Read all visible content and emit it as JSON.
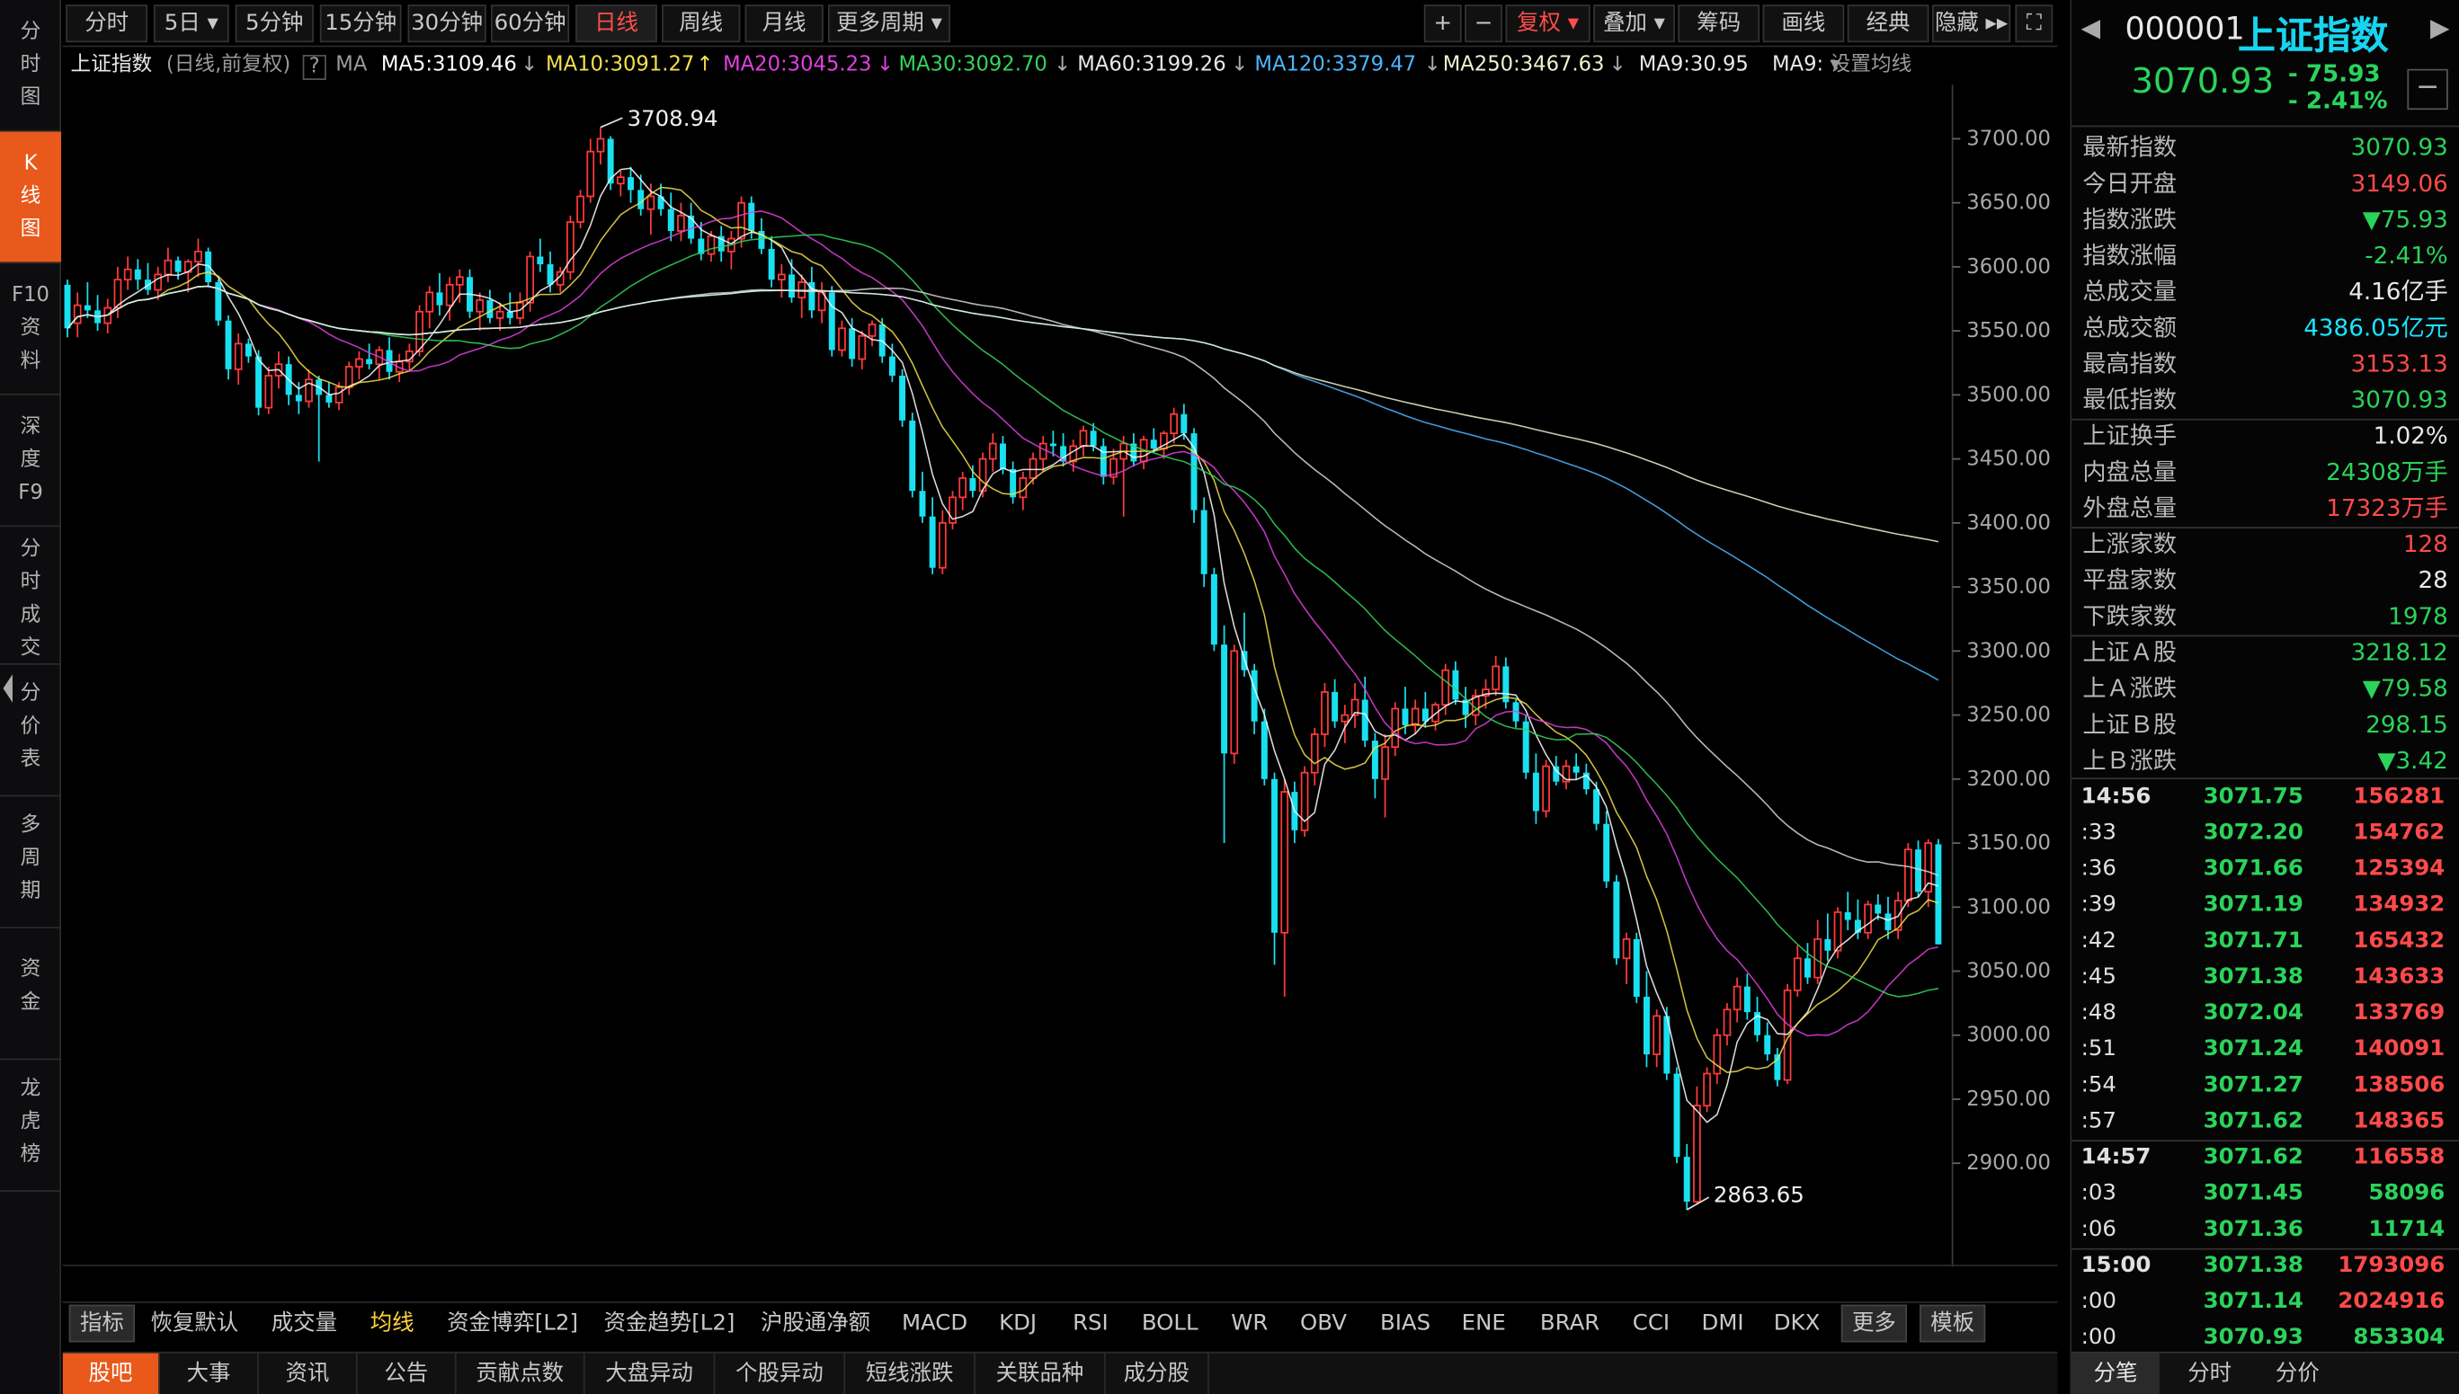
{
  "left_nav": [
    {
      "label": "分\n时\n图"
    },
    {
      "label": "K\n线\n图"
    },
    {
      "label": "F10\n资\n料"
    },
    {
      "label": "深\n度\nF9"
    },
    {
      "label": "分\n时\n成\n交"
    },
    {
      "label": "分\n价\n表"
    },
    {
      "label": "多\n周\n期"
    },
    {
      "label": "资\n金"
    },
    {
      "label": "龙\n虎\n榜"
    }
  ],
  "period_tabs": [
    "分时",
    "5日",
    "5分钟",
    "15分钟",
    "30分钟",
    "60分钟",
    "日线",
    "周线",
    "月线",
    "更多周期"
  ],
  "tools": {
    "plus": "+",
    "minus": "−",
    "fuquan": "复权",
    "diejia": "叠加",
    "chouma": "筹码",
    "huaxian": "画线",
    "jingdian": "经典",
    "yincang": "隐藏",
    "expand": "⛶"
  },
  "ma_bar": {
    "title": "上证指数",
    "mode": "(日线,前复权)",
    "q": "?",
    "ma": "MA",
    "ma5": "MA5:3109.46",
    "ma10": "MA10:3091.27",
    "ma20": "MA20:3045.23",
    "ma30": "MA30:3092.70",
    "ma60": "MA60:3199.26",
    "ma120": "MA120:3379.47",
    "ma250": "MA250:3467.63",
    "ma9": "MA9:30.95",
    "ma9b": "MA9:",
    "setting": "设置均线"
  },
  "chart_data": {
    "type": "candlestick",
    "ylim": [
      2830,
      3730
    ],
    "yticks": [
      "3700.00",
      "3650.00",
      "3600.00",
      "3550.00",
      "3500.00",
      "3450.00",
      "3400.00",
      "3350.00",
      "3300.00",
      "3250.00",
      "3200.00",
      "3150.00",
      "3100.00",
      "3050.00",
      "3000.00",
      "2950.00",
      "2900.00"
    ],
    "high_label": "3708.94",
    "low_label": "2863.65",
    "ohlc": [
      [
        3586,
        3590,
        3545,
        3552
      ],
      [
        3556,
        3580,
        3545,
        3570
      ],
      [
        3570,
        3588,
        3560,
        3566
      ],
      [
        3566,
        3578,
        3550,
        3556
      ],
      [
        3556,
        3575,
        3548,
        3568
      ],
      [
        3568,
        3600,
        3560,
        3590
      ],
      [
        3590,
        3608,
        3582,
        3598
      ],
      [
        3598,
        3606,
        3582,
        3590
      ],
      [
        3590,
        3603,
        3578,
        3582
      ],
      [
        3582,
        3600,
        3574,
        3594
      ],
      [
        3594,
        3615,
        3588,
        3605
      ],
      [
        3605,
        3608,
        3590,
        3596
      ],
      [
        3596,
        3606,
        3580,
        3604
      ],
      [
        3604,
        3622,
        3592,
        3612
      ],
      [
        3612,
        3615,
        3584,
        3588
      ],
      [
        3588,
        3590,
        3554,
        3558
      ],
      [
        3558,
        3562,
        3512,
        3520
      ],
      [
        3520,
        3548,
        3508,
        3540
      ],
      [
        3540,
        3544,
        3525,
        3530
      ],
      [
        3530,
        3535,
        3484,
        3490
      ],
      [
        3490,
        3522,
        3485,
        3515
      ],
      [
        3515,
        3534,
        3505,
        3524
      ],
      [
        3524,
        3530,
        3492,
        3500
      ],
      [
        3500,
        3510,
        3485,
        3495
      ],
      [
        3495,
        3520,
        3490,
        3512
      ],
      [
        3512,
        3515,
        3448,
        3500
      ],
      [
        3500,
        3510,
        3490,
        3494
      ],
      [
        3494,
        3510,
        3488,
        3506
      ],
      [
        3506,
        3526,
        3500,
        3522
      ],
      [
        3522,
        3534,
        3512,
        3528
      ],
      [
        3528,
        3540,
        3520,
        3524
      ],
      [
        3524,
        3538,
        3512,
        3535
      ],
      [
        3535,
        3545,
        3512,
        3518
      ],
      [
        3518,
        3532,
        3510,
        3526
      ],
      [
        3526,
        3540,
        3518,
        3534
      ],
      [
        3534,
        3570,
        3530,
        3565
      ],
      [
        3565,
        3585,
        3552,
        3580
      ],
      [
        3580,
        3595,
        3562,
        3570
      ],
      [
        3570,
        3592,
        3558,
        3586
      ],
      [
        3586,
        3598,
        3572,
        3592
      ],
      [
        3592,
        3598,
        3560,
        3565
      ],
      [
        3565,
        3580,
        3550,
        3574
      ],
      [
        3574,
        3582,
        3556,
        3560
      ],
      [
        3560,
        3572,
        3550,
        3565
      ],
      [
        3565,
        3580,
        3555,
        3560
      ],
      [
        3560,
        3580,
        3555,
        3572
      ],
      [
        3572,
        3612,
        3565,
        3608
      ],
      [
        3608,
        3622,
        3596,
        3602
      ],
      [
        3602,
        3612,
        3580,
        3586
      ],
      [
        3586,
        3600,
        3580,
        3596
      ],
      [
        3596,
        3640,
        3590,
        3635
      ],
      [
        3635,
        3660,
        3630,
        3655
      ],
      [
        3655,
        3700,
        3650,
        3690
      ],
      [
        3690,
        3708.94,
        3680,
        3700
      ],
      [
        3700,
        3702,
        3660,
        3665
      ],
      [
        3665,
        3675,
        3655,
        3670
      ],
      [
        3670,
        3678,
        3650,
        3660
      ],
      [
        3660,
        3672,
        3640,
        3645
      ],
      [
        3645,
        3665,
        3625,
        3655
      ],
      [
        3655,
        3665,
        3640,
        3645
      ],
      [
        3645,
        3658,
        3620,
        3628
      ],
      [
        3628,
        3650,
        3620,
        3640
      ],
      [
        3640,
        3650,
        3618,
        3622
      ],
      [
        3622,
        3635,
        3605,
        3610
      ],
      [
        3610,
        3628,
        3604,
        3624
      ],
      [
        3624,
        3632,
        3604,
        3612
      ],
      [
        3612,
        3628,
        3598,
        3622
      ],
      [
        3622,
        3655,
        3615,
        3650
      ],
      [
        3650,
        3655,
        3622,
        3628
      ],
      [
        3628,
        3638,
        3610,
        3614
      ],
      [
        3614,
        3624,
        3584,
        3590
      ],
      [
        3590,
        3602,
        3576,
        3594
      ],
      [
        3594,
        3606,
        3572,
        3576
      ],
      [
        3576,
        3594,
        3560,
        3588
      ],
      [
        3588,
        3600,
        3560,
        3566
      ],
      [
        3566,
        3588,
        3556,
        3580
      ],
      [
        3580,
        3585,
        3530,
        3535
      ],
      [
        3535,
        3558,
        3530,
        3552
      ],
      [
        3552,
        3560,
        3522,
        3528
      ],
      [
        3528,
        3550,
        3520,
        3546
      ],
      [
        3546,
        3558,
        3538,
        3555
      ],
      [
        3555,
        3560,
        3525,
        3530
      ],
      [
        3530,
        3540,
        3510,
        3515
      ],
      [
        3515,
        3520,
        3475,
        3480
      ],
      [
        3480,
        3486,
        3420,
        3425
      ],
      [
        3425,
        3440,
        3400,
        3405
      ],
      [
        3405,
        3420,
        3360,
        3365
      ],
      [
        3365,
        3410,
        3360,
        3400
      ],
      [
        3400,
        3425,
        3395,
        3420
      ],
      [
        3420,
        3440,
        3410,
        3435
      ],
      [
        3435,
        3445,
        3420,
        3425
      ],
      [
        3425,
        3455,
        3420,
        3450
      ],
      [
        3450,
        3470,
        3440,
        3462
      ],
      [
        3462,
        3468,
        3438,
        3442
      ],
      [
        3442,
        3448,
        3415,
        3420
      ],
      [
        3420,
        3440,
        3410,
        3435
      ],
      [
        3435,
        3455,
        3430,
        3450
      ],
      [
        3450,
        3468,
        3440,
        3462
      ],
      [
        3462,
        3472,
        3452,
        3460
      ],
      [
        3460,
        3470,
        3444,
        3448
      ],
      [
        3448,
        3465,
        3440,
        3460
      ],
      [
        3460,
        3476,
        3452,
        3472
      ],
      [
        3472,
        3478,
        3456,
        3460
      ],
      [
        3460,
        3466,
        3430,
        3436
      ],
      [
        3436,
        3458,
        3430,
        3450
      ],
      [
        3450,
        3468,
        3405,
        3462
      ],
      [
        3462,
        3470,
        3444,
        3448
      ],
      [
        3448,
        3468,
        3442,
        3465
      ],
      [
        3465,
        3474,
        3455,
        3458
      ],
      [
        3458,
        3472,
        3450,
        3470
      ],
      [
        3470,
        3490,
        3462,
        3485
      ],
      [
        3485,
        3493,
        3465,
        3470
      ],
      [
        3470,
        3474,
        3400,
        3410
      ],
      [
        3410,
        3420,
        3350,
        3360
      ],
      [
        3360,
        3365,
        3300,
        3305
      ],
      [
        3305,
        3320,
        3150,
        3220
      ],
      [
        3220,
        3305,
        3212,
        3300
      ],
      [
        3300,
        3330,
        3280,
        3285
      ],
      [
        3285,
        3290,
        3235,
        3245
      ],
      [
        3245,
        3255,
        3195,
        3200
      ],
      [
        3200,
        3205,
        3055,
        3080
      ],
      [
        3080,
        3200,
        3030,
        3190
      ],
      [
        3190,
        3198,
        3150,
        3160
      ],
      [
        3160,
        3210,
        3155,
        3205
      ],
      [
        3205,
        3240,
        3195,
        3235
      ],
      [
        3235,
        3275,
        3225,
        3268
      ],
      [
        3268,
        3278,
        3240,
        3245
      ],
      [
        3245,
        3258,
        3228,
        3250
      ],
      [
        3250,
        3275,
        3240,
        3262
      ],
      [
        3262,
        3280,
        3225,
        3230
      ],
      [
        3230,
        3236,
        3185,
        3200
      ],
      [
        3200,
        3235,
        3170,
        3225
      ],
      [
        3225,
        3260,
        3218,
        3255
      ],
      [
        3255,
        3272,
        3235,
        3242
      ],
      [
        3242,
        3262,
        3235,
        3255
      ],
      [
        3255,
        3268,
        3240,
        3245
      ],
      [
        3245,
        3260,
        3238,
        3258
      ],
      [
        3258,
        3290,
        3250,
        3285
      ],
      [
        3285,
        3292,
        3258,
        3262
      ],
      [
        3262,
        3272,
        3240,
        3250
      ],
      [
        3250,
        3270,
        3242,
        3265
      ],
      [
        3265,
        3278,
        3255,
        3270
      ],
      [
        3270,
        3296,
        3265,
        3288
      ],
      [
        3288,
        3295,
        3255,
        3260
      ],
      [
        3260,
        3262,
        3240,
        3245
      ],
      [
        3245,
        3250,
        3200,
        3205
      ],
      [
        3205,
        3220,
        3165,
        3175
      ],
      [
        3175,
        3215,
        3170,
        3210
      ],
      [
        3210,
        3218,
        3195,
        3198
      ],
      [
        3198,
        3215,
        3192,
        3210
      ],
      [
        3210,
        3220,
        3200,
        3205
      ],
      [
        3205,
        3212,
        3188,
        3192
      ],
      [
        3192,
        3198,
        3160,
        3165
      ],
      [
        3165,
        3175,
        3115,
        3120
      ],
      [
        3120,
        3125,
        3055,
        3060
      ],
      [
        3060,
        3080,
        3040,
        3075
      ],
      [
        3075,
        3080,
        3025,
        3030
      ],
      [
        3030,
        3050,
        2975,
        2985
      ],
      [
        2985,
        3020,
        2975,
        3015
      ],
      [
        3015,
        3022,
        2965,
        2970
      ],
      [
        2970,
        2975,
        2900,
        2905
      ],
      [
        2905,
        2915,
        2863.65,
        2870
      ],
      [
        2870,
        2960,
        2868,
        2945
      ],
      [
        2945,
        2975,
        2940,
        2970
      ],
      [
        2970,
        3005,
        2962,
        3000
      ],
      [
        3000,
        3025,
        2992,
        3020
      ],
      [
        3020,
        3045,
        3010,
        3038
      ],
      [
        3038,
        3048,
        3012,
        3018
      ],
      [
        3018,
        3030,
        2995,
        3000
      ],
      [
        3000,
        3010,
        2980,
        2985
      ],
      [
        2985,
        2990,
        2960,
        2965
      ],
      [
        2965,
        3040,
        2962,
        3035
      ],
      [
        3035,
        3070,
        3030,
        3060
      ],
      [
        3060,
        3072,
        3040,
        3045
      ],
      [
        3045,
        3090,
        3040,
        3075
      ],
      [
        3075,
        3095,
        3058,
        3066
      ],
      [
        3066,
        3100,
        3060,
        3096
      ],
      [
        3096,
        3112,
        3082,
        3090
      ],
      [
        3090,
        3106,
        3075,
        3080
      ],
      [
        3080,
        3105,
        3075,
        3102
      ],
      [
        3102,
        3110,
        3090,
        3095
      ],
      [
        3095,
        3108,
        3075,
        3082
      ],
      [
        3082,
        3112,
        3075,
        3105
      ],
      [
        3105,
        3150,
        3100,
        3145
      ],
      [
        3145,
        3152,
        3108,
        3112
      ],
      [
        3112,
        3153.13,
        3100,
        3150
      ],
      [
        3149.06,
        3153.13,
        3070.93,
        3070.93
      ]
    ]
  },
  "ind_tabs": [
    "指标",
    "恢复默认",
    "成交量",
    "均线",
    "资金博弈[L2]",
    "资金趋势[L2]",
    "沪股通净额",
    "MACD",
    "KDJ",
    "RSI",
    "BOLL",
    "WR",
    "OBV",
    "BIAS",
    "ENE",
    "BRAR",
    "CCI",
    "DMI",
    "DKX",
    "更多",
    "模板"
  ],
  "bottom_tabs": [
    "股吧",
    "大事",
    "资讯",
    "公告",
    "贡献点数",
    "大盘异动",
    "个股异动",
    "短线涨跌",
    "关联品种",
    "成分股"
  ],
  "right": {
    "code": "000001",
    "name": "上证指数",
    "price": "3070.93",
    "chg": "- 75.93",
    "pct": "- 2.41%",
    "rows": [
      [
        "最新指数",
        "3070.93"
      ],
      [
        "今日开盘",
        "3149.06"
      ],
      [
        "指数涨跌",
        "▼75.93"
      ],
      [
        "指数涨幅",
        "-2.41%"
      ],
      [
        "总成交量",
        "4.16亿手"
      ],
      [
        "总成交额",
        "4386.05亿元"
      ],
      [
        "最高指数",
        "3153.13"
      ],
      [
        "最低指数",
        "3070.93"
      ],
      [
        "上证换手",
        "1.02%"
      ],
      [
        "内盘总量",
        "24308万手"
      ],
      [
        "外盘总量",
        "17323万手"
      ],
      [
        "上涨家数",
        "128"
      ],
      [
        "平盘家数",
        "28"
      ],
      [
        "下跌家数",
        "1978"
      ],
      [
        "上证Ａ股",
        "3218.12"
      ],
      [
        "上Ａ涨跌",
        "▼79.58"
      ],
      [
        "上证Ｂ股",
        "298.15"
      ],
      [
        "上Ｂ涨跌",
        "▼3.42"
      ]
    ],
    "ticks": [
      [
        "14:56",
        "3071.75",
        "156281"
      ],
      [
        ":33",
        "3072.20",
        "154762"
      ],
      [
        ":36",
        "3071.66",
        "125394"
      ],
      [
        ":39",
        "3071.19",
        "134932"
      ],
      [
        ":42",
        "3071.71",
        "165432"
      ],
      [
        ":45",
        "3071.38",
        "143633"
      ],
      [
        ":48",
        "3072.04",
        "133769"
      ],
      [
        ":51",
        "3071.24",
        "140091"
      ],
      [
        ":54",
        "3071.27",
        "138506"
      ],
      [
        ":57",
        "3071.62",
        "148365"
      ],
      [
        "14:57",
        "3071.62",
        "116558"
      ],
      [
        ":03",
        "3071.45",
        "58096"
      ],
      [
        ":06",
        "3071.36",
        "11714"
      ],
      [
        "15:00",
        "3071.38",
        "1793096"
      ],
      [
        ":00",
        "3071.14",
        "2024916"
      ],
      [
        ":00",
        "3070.93",
        "853304"
      ]
    ],
    "foot": [
      "分笔",
      "分时",
      "分价"
    ]
  },
  "colors": {
    "up": "#ff3a3a",
    "down": "#19e0f0",
    "accent": "#e8591b"
  }
}
